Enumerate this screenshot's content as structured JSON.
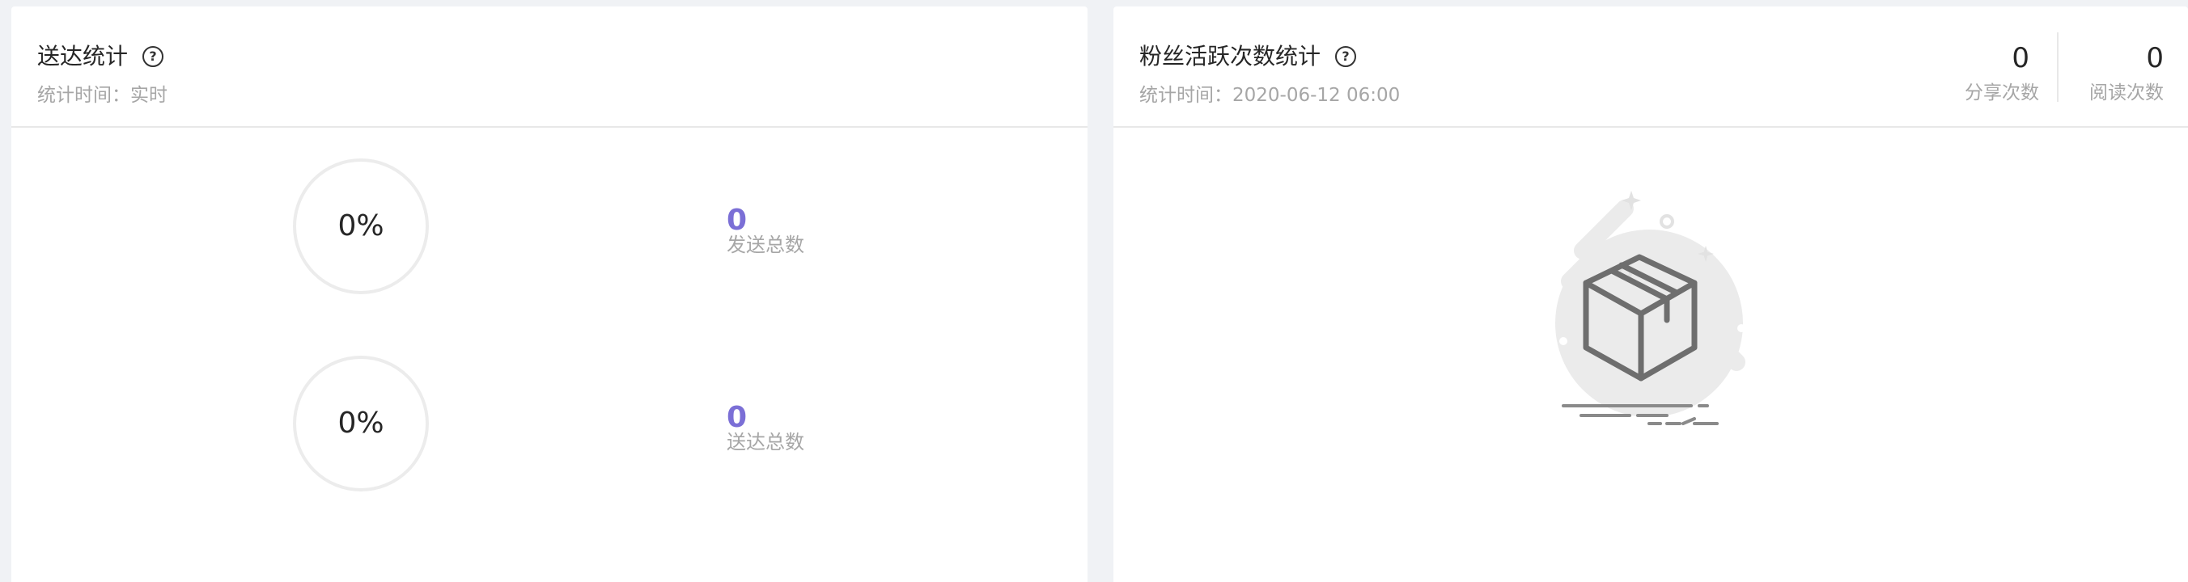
{
  "delivery_panel": {
    "title": "送达统计",
    "subtitle": "统计时间：实时",
    "stats": [
      {
        "percent": "0%",
        "value": "0",
        "label": "发送总数",
        "percent_value": 0
      },
      {
        "percent": "0%",
        "value": "0",
        "label": "送达总数",
        "percent_value": 0
      }
    ]
  },
  "fans_panel": {
    "title": "粉丝活跃次数统计",
    "subtitle": "统计时间：2020-06-12 06:00",
    "metrics": [
      {
        "value": "0",
        "label": "分享次数"
      },
      {
        "value": "0",
        "label": "阅读次数"
      }
    ],
    "empty_state_icon": "empty-box-icon"
  },
  "colors": {
    "accent": "#7b6fd6",
    "background": "#f0f2f5",
    "muted_text": "#a6a6a6",
    "ring": "#ececec"
  }
}
